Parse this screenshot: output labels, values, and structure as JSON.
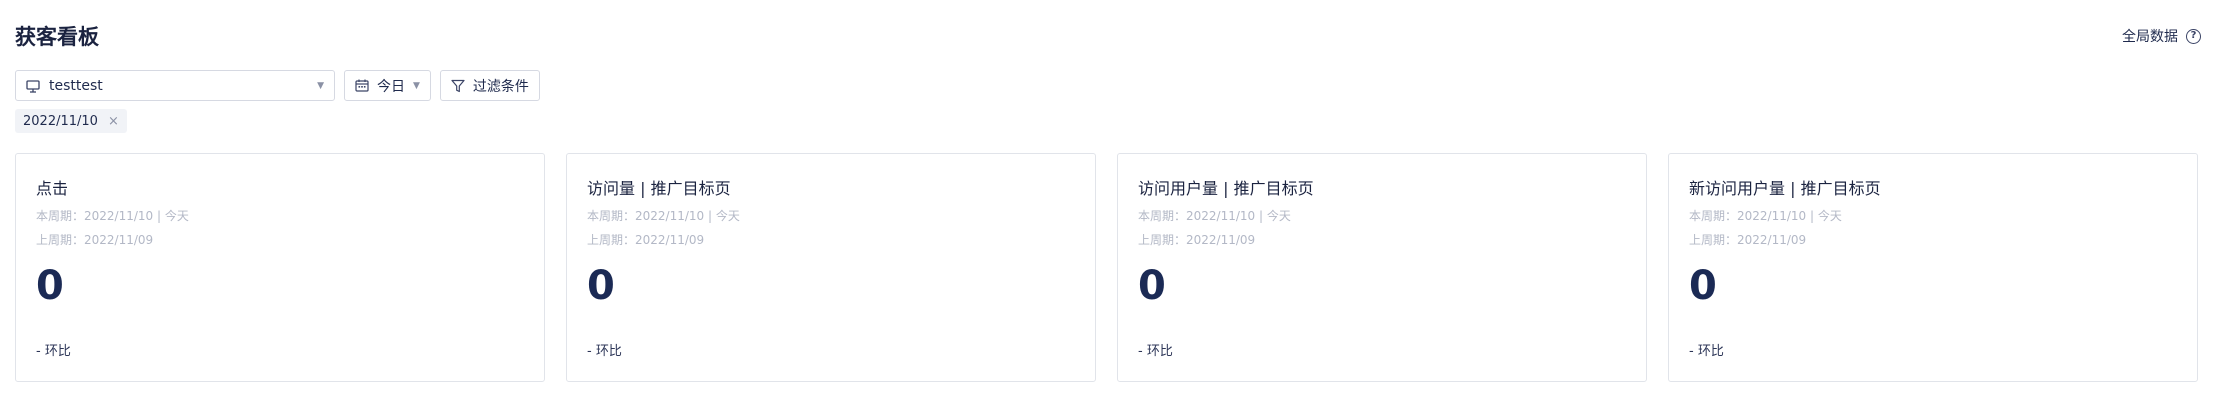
{
  "header": {
    "title": "获客看板",
    "global_label": "全局数据",
    "help_symbol": "?"
  },
  "toolbar": {
    "site_value": "testtest",
    "date_value": "今日",
    "filter_label": "过滤条件"
  },
  "active_tag": {
    "label": "2022/11/10",
    "close_symbol": "×"
  },
  "cards": [
    {
      "title": "点击",
      "current_period": "本周期：2022/11/10 | 今天",
      "previous_period": "上周期：2022/11/09",
      "value": "0",
      "compare": "- 环比"
    },
    {
      "title": "访问量 | 推广目标页",
      "current_period": "本周期：2022/11/10 | 今天",
      "previous_period": "上周期：2022/11/09",
      "value": "0",
      "compare": "- 环比"
    },
    {
      "title": "访问用户量 | 推广目标页",
      "current_period": "本周期：2022/11/10 | 今天",
      "previous_period": "上周期：2022/11/09",
      "value": "0",
      "compare": "- 环比"
    },
    {
      "title": "新访问用户量 | 推广目标页",
      "current_period": "本周期：2022/11/10 | 今天",
      "previous_period": "上周期：2022/11/09",
      "value": "0",
      "compare": "- 环比"
    }
  ]
}
